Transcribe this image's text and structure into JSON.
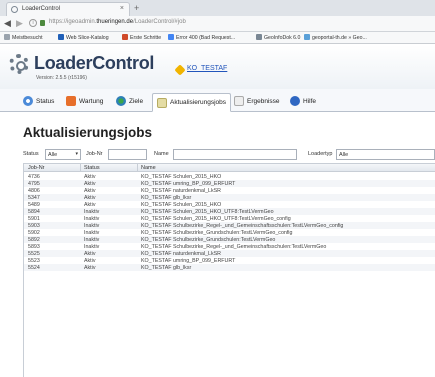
{
  "browser": {
    "tab_title": "LoaderControl",
    "tab_close": "×",
    "new_tab": "+",
    "url_prefix": "https://igeoadmin.",
    "url_host": "thueringen.de",
    "url_path": "/LoaderControl/#job",
    "bookmarks": [
      {
        "label": "Meistbesucht",
        "color": "#9aa3ad"
      },
      {
        "label": "Web Slice-Katalog",
        "color": "#1f5fb8"
      },
      {
        "label": "Erste Schritte",
        "color": "#d04a2a"
      },
      {
        "label": "Error 400 (Bad Request...",
        "color": "#4285f4"
      },
      {
        "label": "GeoInfoDok 6.0",
        "color": "#7a8794"
      },
      {
        "label": "geoportal-th.de » Geo...",
        "color": "#5aa0d8"
      }
    ]
  },
  "app": {
    "title": "LoaderControl",
    "version": "Version: 2.5.5 (r15196)",
    "user": "KO_TESTAF"
  },
  "tabs": [
    {
      "label": "Status",
      "icon": "status-icon"
    },
    {
      "label": "Wartung",
      "icon": "wartung-icon"
    },
    {
      "label": "Ziele",
      "icon": "ziele-icon"
    },
    {
      "label": "Aktualisierungsjobs",
      "icon": "aktualisierungsjobs-icon",
      "active": true
    },
    {
      "label": "Ergebnisse",
      "icon": "ergebnisse-icon"
    },
    {
      "label": "Hilfe",
      "icon": "hilfe-icon"
    }
  ],
  "page_title": "Aktualisierungsjobs",
  "filters": {
    "status_label": "Status",
    "status_value": "Alle",
    "jobnr_label": "Job-Nr",
    "jobnr_value": "",
    "name_label": "Name",
    "name_value": "",
    "loadertyp_label": "Loadertyp",
    "loadertyp_value": "Alle"
  },
  "table": {
    "columns": [
      "Job-Nr",
      "Status",
      "Name"
    ],
    "rows": [
      [
        "4736",
        "Aktiv",
        "KO_TESTAF Schulen_2015_HKO"
      ],
      [
        "4795",
        "Aktiv",
        "KO_TESTAF umring_BP_099_ERFURT"
      ],
      [
        "4806",
        "Aktiv",
        "KO_TESTAF naturdenkmal_LkSR"
      ],
      [
        "5347",
        "Aktiv",
        "KO_TESTAF glb_lksr"
      ],
      [
        "5489",
        "Aktiv",
        "KO_TESTAF Schulen_2015_HKO"
      ],
      [
        "5894",
        "Inaktiv",
        "KO_TESTAF Schulen_2015_HKO_UTF8:TestLVermGeo"
      ],
      [
        "5901",
        "Inaktiv",
        "KO_TESTAF Schulen_2015_HKO_UTF8:TestLVermGeo_config"
      ],
      [
        "5903",
        "Inaktiv",
        "KO_TESTAF Schulbezirke_Regel-_und_Gemeinschaftsschulen:TestLVermGeo_config"
      ],
      [
        "5902",
        "Inaktiv",
        "KO_TESTAF Schulbezirke_Grundschulen:TestLVermGeo_config"
      ],
      [
        "5892",
        "Inaktiv",
        "KO_TESTAF Schulbezirke_Grundschulen:TestLVermGeo"
      ],
      [
        "5893",
        "Inaktiv",
        "KO_TESTAF Schulbezirke_Regel-_und_Gemeinschaftsschulen:TestLVermGeo"
      ],
      [
        "5525",
        "Aktiv",
        "KO_TESTAF naturdenkmal_LkSR"
      ],
      [
        "5523",
        "Aktiv",
        "KO_TESTAF umring_BP_099_ERFURT"
      ],
      [
        "5524",
        "Aktiv",
        "KO_TESTAF glb_lksr"
      ]
    ]
  }
}
